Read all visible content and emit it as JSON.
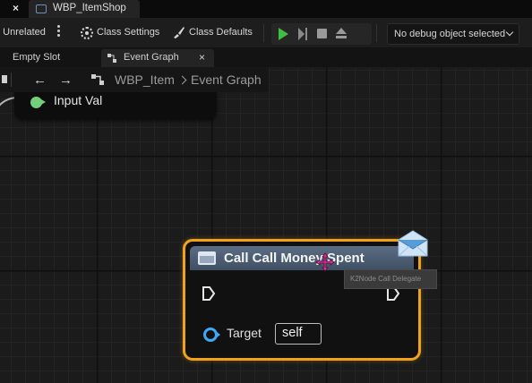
{
  "top_tabs": {
    "close_glyph": "×",
    "document_tab": {
      "label": "WBP_ItemShop",
      "icon": "blueprint-icon"
    }
  },
  "toolbar": {
    "unrelated_label": "e Unrelated",
    "class_settings_label": "Class Settings",
    "class_defaults_label": "Class Defaults",
    "debug_select_label": "No debug object selected",
    "play_color": "#3fbf3f"
  },
  "editor_tabs": [
    {
      "label": "Empty Slot",
      "active": false
    },
    {
      "label": "Event Graph",
      "active": true,
      "close_glyph": "×"
    }
  ],
  "breadcrumb": {
    "back_glyph": "←",
    "forward_glyph": "→",
    "widget": "WBP_Item",
    "graph": "Event Graph"
  },
  "input_node": {
    "label": "Input Val",
    "pin_color": "#73d07a"
  },
  "call_node": {
    "title": "Call Call Money Spent",
    "target_label": "Target",
    "target_value": "self",
    "accent": "#f0a21b",
    "target_pin_color": "#3fa9f5"
  },
  "tooltip": {
    "text": "K2Node Call Delegate"
  }
}
